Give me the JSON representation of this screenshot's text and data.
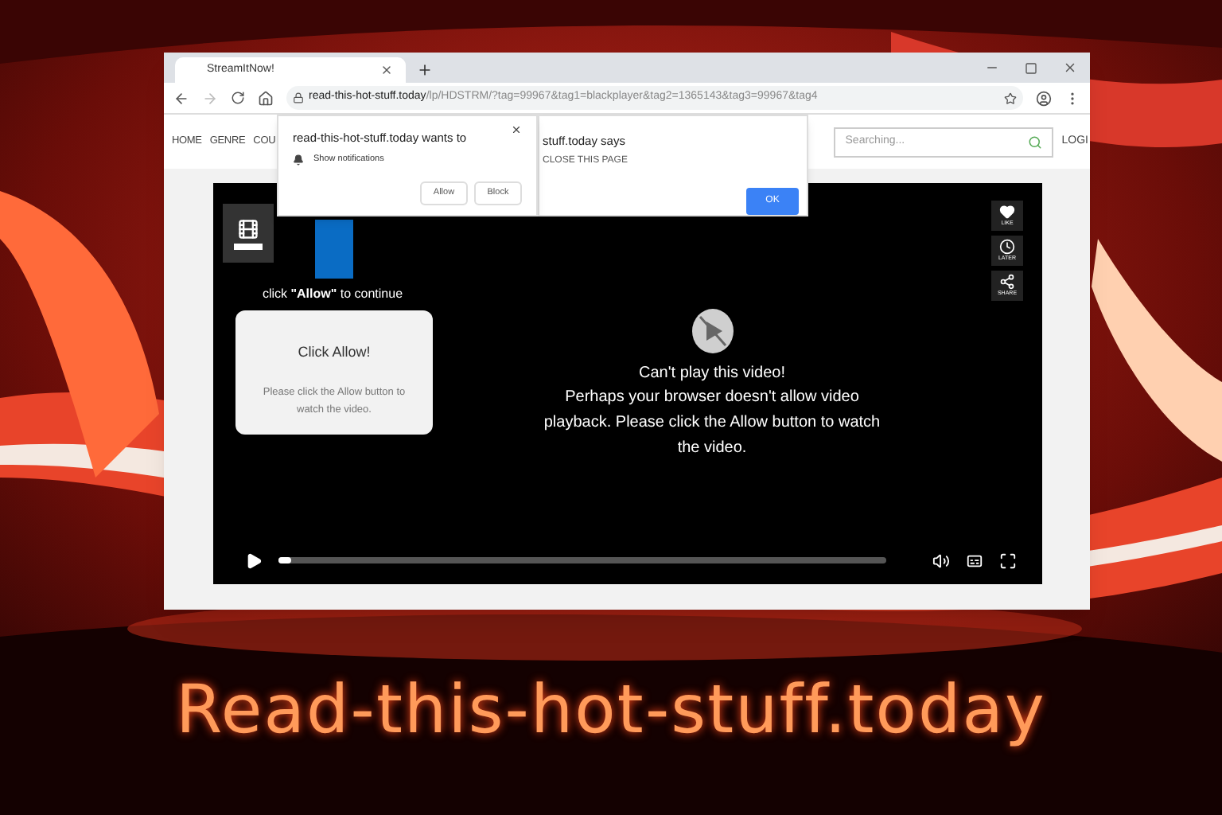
{
  "browser": {
    "tab": {
      "title": "StreamItNow!"
    },
    "address": {
      "domain": "read-this-hot-stuff.today",
      "path": "/lp/HDSTRM/?tag=99967&tag1=blackplayer&tag2=1365143&tag3=99967&tag4"
    }
  },
  "site": {
    "nav": [
      "HOME",
      "GENRE",
      "COU"
    ],
    "search": {
      "placeholder": "Searching..."
    },
    "login": "LOGI"
  },
  "permission_popup": {
    "title": "read-this-hot-stuff.today wants to",
    "item": "Show notifications",
    "buttons": [
      "Allow",
      "Block"
    ]
  },
  "alert": {
    "title": "stuff.today says",
    "message": "CLOSE THIS PAGE",
    "button": "OK"
  },
  "player": {
    "prompt": "click **\"Allow\"** to continue",
    "card": {
      "title": "Click Allow!",
      "text": "Please click the Allow button to watch the video."
    },
    "message": {
      "title": "Can't play this video!",
      "body": "Perhaps your browser doesn't allow video playback. Please click the Allow button to watch the video."
    },
    "side_buttons": [
      {
        "kind": "like",
        "label": "LIKE"
      },
      {
        "kind": "later",
        "label": "LATER"
      },
      {
        "kind": "share",
        "label": "SHARE"
      }
    ],
    "progress": {
      "level": 0.02
    }
  },
  "caption": "Read-this-hot-stuff.today"
}
